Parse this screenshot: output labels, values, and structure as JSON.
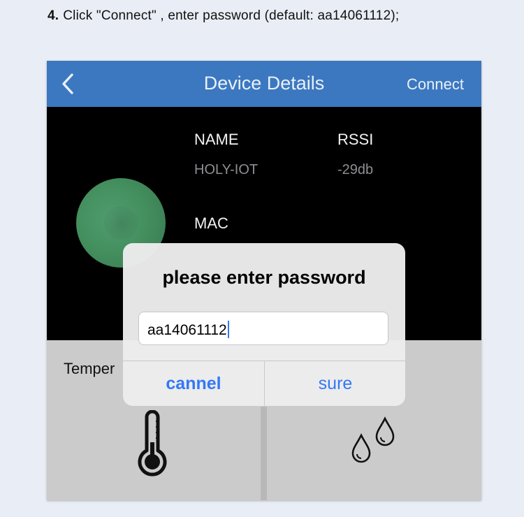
{
  "caption": {
    "step": "4.",
    "text": "Click \"Connect\" , enter password (default: aa14061112);"
  },
  "navbar": {
    "title": "Device Details",
    "connect_label": "Connect",
    "back_icon": "chevron-left-icon"
  },
  "device": {
    "name_label": "NAME",
    "name_value": "HOLY-IOT",
    "rssi_label": "RSSI",
    "rssi_value": "-29db",
    "mac_label": "MAC"
  },
  "sensors": {
    "temperature_label": "Temper",
    "temperature_icon": "thermometer-icon",
    "humidity_icon": "water-drops-icon"
  },
  "dialog": {
    "title": "please enter password",
    "password_value": "aa14061112",
    "cancel_label": "cannel",
    "sure_label": "sure"
  },
  "colors": {
    "navbar": "#3c78c0",
    "accent": "#3478f6",
    "device": "#45905f"
  }
}
